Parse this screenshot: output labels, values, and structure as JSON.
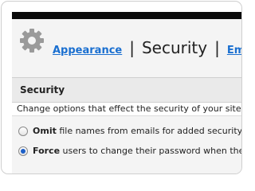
{
  "tabs": {
    "appearance": "Appearance",
    "current": "Security",
    "email": "Email",
    "separator": "|"
  },
  "section": {
    "title": "Security",
    "description": "Change options that effect the security of your site"
  },
  "options": [
    {
      "keyword": "Omit",
      "text": " file names from emails for added security.",
      "checked": false
    },
    {
      "keyword": "Force",
      "text": " users to change their password when they lo",
      "checked": true
    }
  ],
  "icons": {
    "settings": "gear-icon"
  }
}
